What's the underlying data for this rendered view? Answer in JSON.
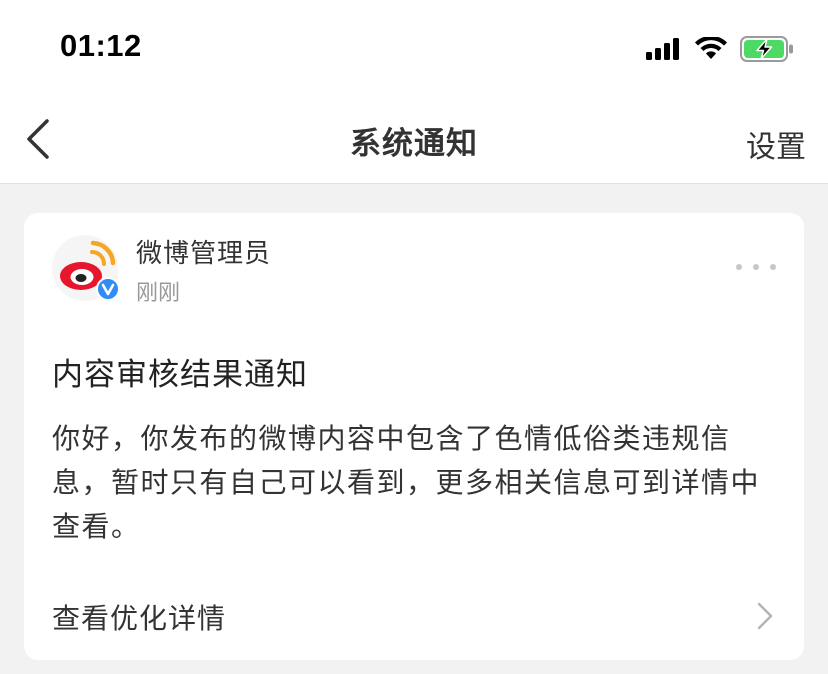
{
  "status_bar": {
    "time": "01:12",
    "icons": [
      "signal-icon",
      "wifi-icon",
      "battery-charging-icon"
    ],
    "battery_color": "#4cd964"
  },
  "nav": {
    "back_icon": "chevron-left-icon",
    "title": "系统通知",
    "settings_label": "设置"
  },
  "notification": {
    "sender": {
      "name": "微博管理员",
      "time": "刚刚",
      "avatar_icon": "weibo-logo-icon",
      "verified_icon": "verified-v-icon",
      "verified_color": "#2f8df5"
    },
    "more_icon": "more-dots-icon",
    "title": "内容审核结果通知",
    "body": "你好，你发布的微博内容中包含了色情低俗类违规信息，暂时只有自己可以看到，更多相关信息可到详情中查看。",
    "detail_label": "查看优化详情",
    "detail_icon": "chevron-right-icon"
  },
  "colors": {
    "weibo_red": "#e6162d",
    "weibo_orange": "#f5a623",
    "background": "#f2f2f2"
  }
}
